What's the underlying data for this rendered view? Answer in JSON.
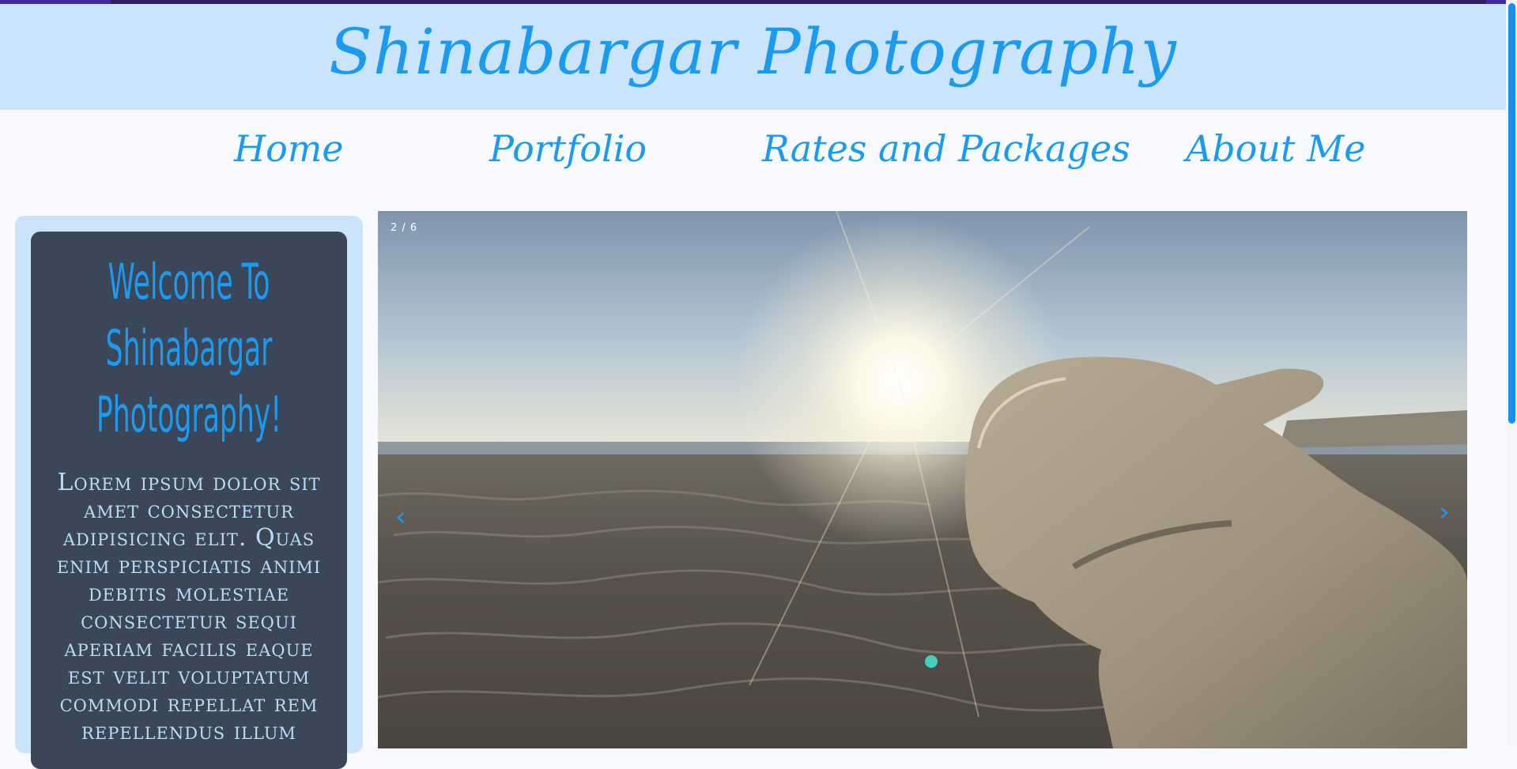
{
  "header": {
    "title": "Shinabargar Photography"
  },
  "nav": {
    "items": [
      {
        "label": "Home"
      },
      {
        "label": "Portfolio"
      },
      {
        "label": "Rates and Packages"
      },
      {
        "label": "About Me"
      }
    ]
  },
  "sidebar": {
    "welcome_title": "Welcome To Shinabargar Photography!",
    "welcome_text": "Lorem ipsum dolor sit amet consectetur adipisicing elit. Quas enim perspiciatis animi debitis molestiae consectetur sequi aperiam facilis eaque est velit voluptatum commodi repellat rem repellendus illum"
  },
  "slideshow": {
    "counter": "2 / 6",
    "prev_symbol": "‹",
    "next_symbol": "›"
  },
  "colors": {
    "accent": "#1a9bef",
    "header_bg": "#c9e4fb",
    "card_bg": "#3b4658",
    "card_text": "#b9dcf7",
    "page_bg": "#f8faff"
  }
}
